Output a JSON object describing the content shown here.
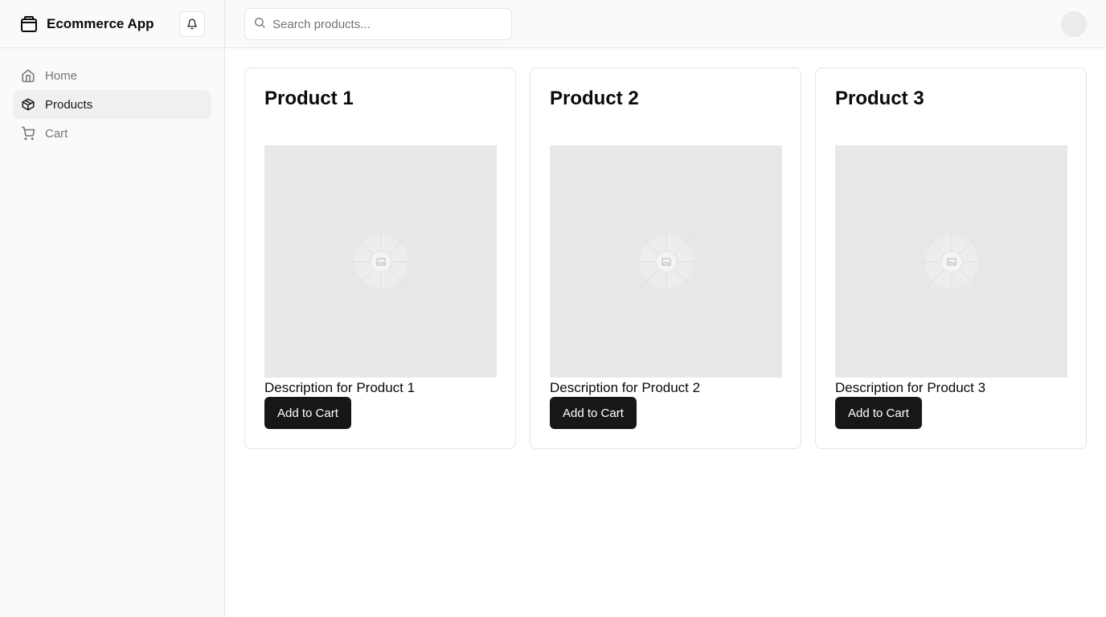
{
  "sidebar": {
    "brand_title": "Ecommerce App",
    "brand_icon": "store-icon",
    "bell_icon": "bell-icon",
    "items": [
      {
        "label": "Home",
        "icon": "home-icon",
        "active": false
      },
      {
        "label": "Products",
        "icon": "package-icon",
        "active": true
      },
      {
        "label": "Cart",
        "icon": "cart-icon",
        "active": false
      }
    ]
  },
  "topbar": {
    "search": {
      "placeholder": "Search products...",
      "value": ""
    }
  },
  "products": [
    {
      "title": "Product 1",
      "description": "Description for Product 1",
      "button_label": "Add to Cart"
    },
    {
      "title": "Product 2",
      "description": "Description for Product 2",
      "button_label": "Add to Cart"
    },
    {
      "title": "Product 3",
      "description": "Description for Product 3",
      "button_label": "Add to Cart"
    }
  ],
  "colors": {
    "primary_button": "#171717",
    "sidebar_bg": "#fafafa",
    "active_item_bg": "#f0f0f0",
    "image_placeholder": "#e8e8e8"
  }
}
